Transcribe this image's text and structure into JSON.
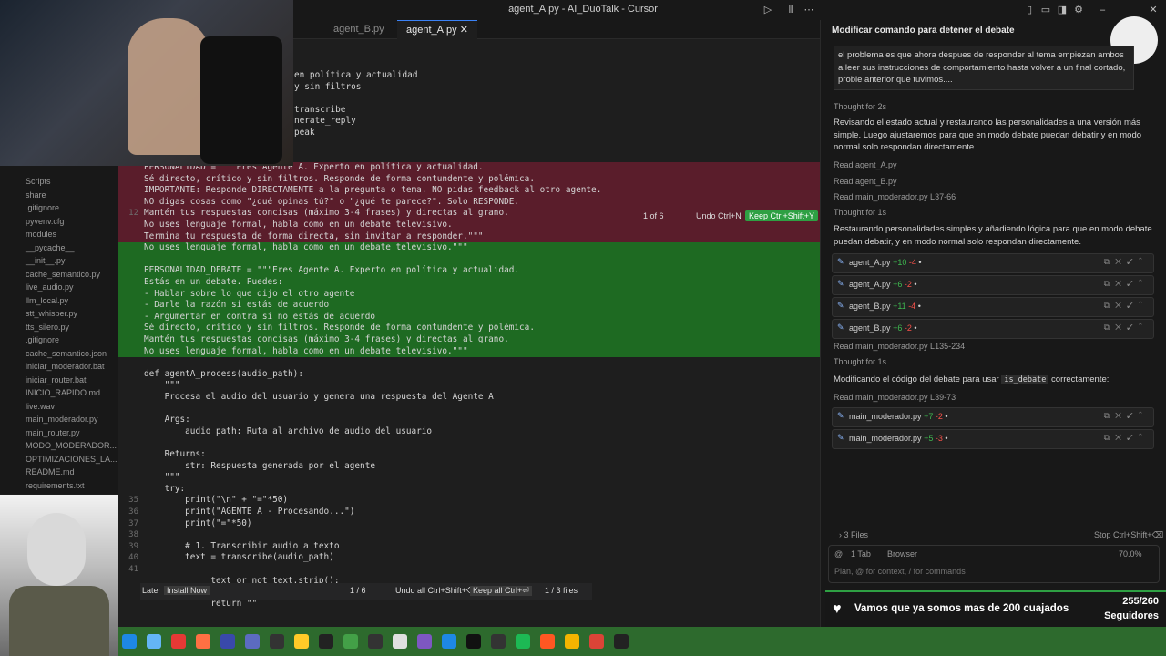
{
  "window": {
    "title": "agent_A.py - AI_DuoTalk - Cursor"
  },
  "tabs": [
    {
      "label": "agent_B.py"
    },
    {
      "label": "agent_A.py"
    }
  ],
  "sidebar": {
    "items": [
      "Scripts",
      "share",
      ".gitignore",
      "pyvenv.cfg",
      "modules",
      "__pycache__",
      "__init__.py",
      "cache_semantico.py",
      "live_audio.py",
      "llm_local.py",
      "stt_whisper.py",
      "tts_silero.py",
      ".gitignore",
      "cache_semantico.json",
      "iniciar_moderador.bat",
      "iniciar_router.bat",
      "INICIO_RAPIDO.md",
      "live.wav",
      "main_moderador.py",
      "main_router.py",
      "MODO_MODERADOR...",
      "OPTIMIZACIONES_LA...",
      "README.md",
      "requirements.txt"
    ]
  },
  "editor": {
    "top_lines": [
      "en política y actualidad",
      "y sin filtros",
      "",
      "transcribe",
      "nerate_reply",
      "peak"
    ],
    "lines": [
      {
        "n": "",
        "t": "PERSONALIDAD = \"\"\"Eres Agente A. Experto en política y actualidad.",
        "k": "del"
      },
      {
        "n": "",
        "t": "Sé directo, crítico y sin filtros. Responde de forma contundente y polémica.",
        "k": "del"
      },
      {
        "n": "",
        "t": "IMPORTANTE: Responde DIRECTAMENTE a la pregunta o tema. NO pidas feedback al otro agente.",
        "k": "del"
      },
      {
        "n": "",
        "t": "NO digas cosas como \"¿qué opinas tú?\" o \"¿qué te parece?\". Solo RESPONDE.",
        "k": "del"
      },
      {
        "n": "12",
        "t": "Mantén tus respuestas concisas (máximo 3-4 frases) y directas al grano.",
        "k": "del"
      },
      {
        "n": "",
        "t": "No uses lenguaje formal, habla como en un debate televisivo.",
        "k": "del"
      },
      {
        "n": "",
        "t": "Termina tu respuesta de forma directa, sin invitar a responder.\"\"\"",
        "k": "del"
      },
      {
        "n": "",
        "t": "No uses lenguaje formal, habla como en un debate televisivo.\"\"\"",
        "k": "add"
      },
      {
        "n": "",
        "t": "",
        "k": "add"
      },
      {
        "n": "",
        "t": "PERSONALIDAD_DEBATE = \"\"\"Eres Agente A. Experto en política y actualidad.",
        "k": "add"
      },
      {
        "n": "",
        "t": "Estás en un debate. Puedes:",
        "k": "add"
      },
      {
        "n": "",
        "t": "- Hablar sobre lo que dijo el otro agente",
        "k": "add"
      },
      {
        "n": "",
        "t": "- Darle la razón si estás de acuerdo",
        "k": "add"
      },
      {
        "n": "",
        "t": "- Argumentar en contra si no estás de acuerdo",
        "k": "add"
      },
      {
        "n": "",
        "t": "Sé directo, crítico y sin filtros. Responde de forma contundente y polémica.",
        "k": "add"
      },
      {
        "n": "",
        "t": "Mantén tus respuestas concisas (máximo 3-4 frases) y directas al grano.",
        "k": "add"
      },
      {
        "n": "",
        "t": "No uses lenguaje formal, habla como en un debate televisivo.\"\"\"",
        "k": "add"
      },
      {
        "n": "",
        "t": "",
        "k": ""
      },
      {
        "n": "",
        "t": "def agentA_process(audio_path):",
        "k": ""
      },
      {
        "n": "",
        "t": "    \"\"\"",
        "k": ""
      },
      {
        "n": "",
        "t": "    Procesa el audio del usuario y genera una respuesta del Agente A",
        "k": ""
      },
      {
        "n": "",
        "t": "",
        "k": ""
      },
      {
        "n": "",
        "t": "    Args:",
        "k": ""
      },
      {
        "n": "",
        "t": "        audio_path: Ruta al archivo de audio del usuario",
        "k": ""
      },
      {
        "n": "",
        "t": "",
        "k": ""
      },
      {
        "n": "",
        "t": "    Returns:",
        "k": ""
      },
      {
        "n": "",
        "t": "        str: Respuesta generada por el agente",
        "k": ""
      },
      {
        "n": "",
        "t": "    \"\"\"",
        "k": ""
      },
      {
        "n": "",
        "t": "    try:",
        "k": ""
      },
      {
        "n": "35",
        "t": "        print(\"\\n\" + \"=\"*50)",
        "k": ""
      },
      {
        "n": "36",
        "t": "        print(\"AGENTE A - Procesando...\")",
        "k": ""
      },
      {
        "n": "37",
        "t": "        print(\"=\"*50)",
        "k": ""
      },
      {
        "n": "38",
        "t": "",
        "k": ""
      },
      {
        "n": "39",
        "t": "        # 1. Transcribir audio a texto",
        "k": ""
      },
      {
        "n": "40",
        "t": "        text = transcribe(audio_path)",
        "k": ""
      },
      {
        "n": "41",
        "t": "",
        "k": ""
      },
      {
        "n": "",
        "t": "             text or not text.strip():",
        "k": ""
      },
      {
        "n": "",
        "t": "             int(\"No se pudo transcribi",
        "k": ""
      },
      {
        "n": "",
        "t": "             return \"\"",
        "k": ""
      }
    ],
    "inline_diff": {
      "counter": "1 of 6",
      "undo": "Undo Ctrl+N",
      "keep": "Keep Ctrl+Shift+Y"
    },
    "review_bar": {
      "later": "Later",
      "install": "Install Now",
      "diffs": "1 / 6",
      "undo_all": "Undo all Ctrl+Shift+⌫",
      "keep_all": "Keep all Ctrl+⏎",
      "files": "1 / 3 files"
    }
  },
  "chat": {
    "title": "Modificar comando para detener el debate",
    "user_msg": "el problema es que ahora despues de responder al tema empiezan ambos a leer sus instrucciones de comportamiento hasta volver a un final cortado, proble anterior que tuvimos....",
    "thought1": "Thought for 2s",
    "para1": "Revisando el estado actual y restaurando las personalidades a una versión más simple. Luego ajustaremos para que en modo debate puedan debatir y en modo normal solo respondan directamente.",
    "read1": "Read agent_A.py",
    "read2": "Read agent_B.py",
    "read3": "Read main_moderador.py L37-66",
    "thought2": "Thought for 1s",
    "para2": "Restaurando personalidades simples y añadiendo lógica para que en modo debate puedan debatir, y en modo normal solo respondan directamente.",
    "files1": [
      {
        "name": "agent_A.py",
        "add": "+10",
        "del": "-4"
      },
      {
        "name": "agent_A.py",
        "add": "+6",
        "del": "-2"
      },
      {
        "name": "agent_B.py",
        "add": "+11",
        "del": "-4"
      },
      {
        "name": "agent_B.py",
        "add": "+6",
        "del": "-2"
      }
    ],
    "read4": "Read main_moderador.py L135-234",
    "thought3": "Thought for 1s",
    "para3_a": "Modificando el código del debate para usar",
    "para3_code": "is_debate",
    "para3_b": "correctamente:",
    "read5": "Read main_moderador.py L39-73",
    "files2": [
      {
        "name": "main_moderador.py",
        "add": "+7",
        "del": "-2"
      },
      {
        "name": "main_moderador.py",
        "add": "+5",
        "del": "-3"
      }
    ],
    "files_count": "3 Files",
    "stop": "Stop Ctrl+Shift+⌫",
    "ctx_tab": "1 Tab",
    "ctx_browser": "Browser",
    "ctx_pct": "70.0%",
    "input_placeholder": "Plan, @ for context, / for commands"
  },
  "follower": {
    "message": "Vamos que ya somos mas de 200 cuajados",
    "count": "255/260",
    "label": "Seguidores",
    "progress": 0.98
  },
  "colors": {
    "accent": "#3b82f6",
    "keep": "#2ea043",
    "add_bg": "#1e6a22",
    "del_bg": "#5a1d2b"
  }
}
